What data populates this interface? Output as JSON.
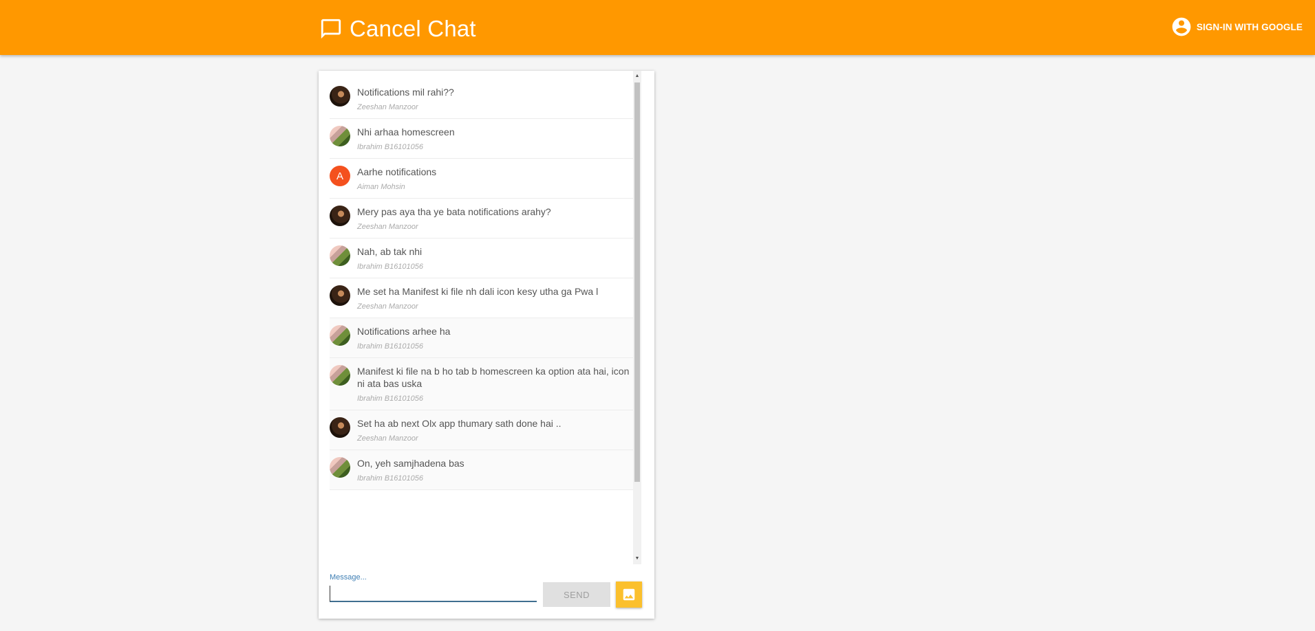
{
  "header": {
    "title": "Cancel Chat",
    "signin_label": "SIGN-IN WITH GOOGLE",
    "color": "#ff9800"
  },
  "messages": [
    {
      "text": "Notifications mil rahi??",
      "author": "Zeeshan Manzoor",
      "avatar": "photo"
    },
    {
      "text": "Nhi arhaa homescreen",
      "author": "Ibrahim B16101056",
      "avatar": "photo"
    },
    {
      "text": "Aarhe notifications",
      "author": "Aiman Mohsin",
      "avatar_letter": "A"
    },
    {
      "text": "Mery pas aya tha ye bata notifications arahy?",
      "author": "Zeeshan Manzoor",
      "avatar": "photo"
    },
    {
      "text": "Nah, ab tak nhi",
      "author": "Ibrahim B16101056",
      "avatar": "photo"
    },
    {
      "text": "Me set ha Manifest ki file nh dali icon kesy utha ga Pwa l",
      "author": "Zeeshan Manzoor",
      "avatar": "photo"
    },
    {
      "text": "Notifications arhee ha",
      "author": "Ibrahim B16101056",
      "avatar": "photo"
    },
    {
      "text": "Manifest ki file na b ho tab b homescreen ka option ata hai, icon ni ata bas uska",
      "author": "Ibrahim B16101056",
      "avatar": "photo"
    },
    {
      "text": "Set ha ab next Olx app thumary sath done hai ..",
      "author": "Zeeshan Manzoor",
      "avatar": "photo"
    },
    {
      "text": "On, yeh samjhadena bas",
      "author": "Ibrahim B16101056",
      "avatar": "photo"
    }
  ],
  "form": {
    "message_label": "Message...",
    "message_value": "",
    "send_label": "SEND",
    "image_button_color": "#fbc02d"
  }
}
